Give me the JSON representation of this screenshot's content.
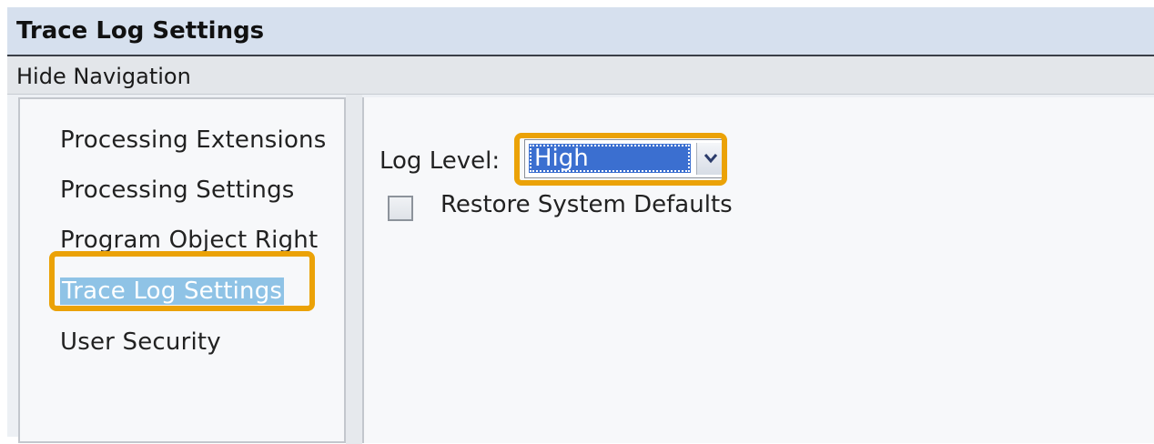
{
  "window": {
    "title": "Trace Log Settings"
  },
  "navigation": {
    "toggle_label": "Hide Navigation",
    "items": [
      {
        "label": "Processing Extensions"
      },
      {
        "label": "Processing Settings"
      },
      {
        "label": "Program Object Right"
      },
      {
        "label": "Trace Log Settings",
        "selected": true
      },
      {
        "label": "User Security"
      }
    ]
  },
  "settings": {
    "log_level_label": "Log Level:",
    "log_level_value": "High",
    "restore_defaults_label": "Restore System Defaults",
    "restore_defaults_checked": false
  },
  "colors": {
    "highlight": "#eba207",
    "selection": "#8fc3e6",
    "select_fill": "#3b6fd0"
  },
  "icons": {
    "dropdown": "chevron-down-icon"
  }
}
